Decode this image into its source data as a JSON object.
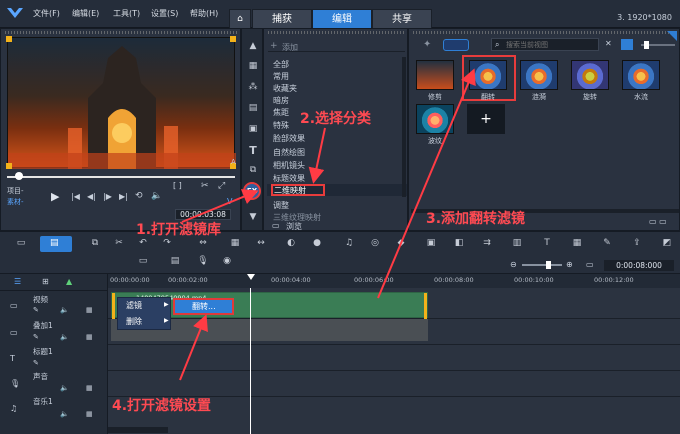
{
  "menu": {
    "file": "文件(F)",
    "edit": "编辑(E)",
    "tools": "工具(T)",
    "settings": "设置(S)",
    "help": "帮助(H)"
  },
  "tabs": {
    "capture": "捕获",
    "edit": "编辑",
    "share": "共享"
  },
  "resolution": "3. 1920*1080",
  "library": {
    "add": "添加",
    "search_placeholder": "搜索当前视图",
    "browse": "浏览"
  },
  "categories": [
    "全部",
    "常用",
    "收藏夹",
    "暗房",
    "焦距",
    "特殊",
    "脸部效果",
    "自然绘图",
    "相机镜头",
    "标题效果",
    "二维映射",
    "调整",
    "三维纹理映射"
  ],
  "selected_category": "二维映射",
  "thumbs": [
    {
      "label": "修剪"
    },
    {
      "label": "翻转"
    },
    {
      "label": "涟漪"
    },
    {
      "label": "旋转"
    },
    {
      "label": "水流"
    },
    {
      "label": "波纹"
    }
  ],
  "preview": {
    "project": "项目-",
    "clip": "素材-",
    "timecode": "00:00:03:08"
  },
  "timeline": {
    "ruler": [
      "00:00:00:00",
      "00:00:02:00",
      "00:00:04:00",
      "00:00:06:00",
      "00:00:08:00",
      "00:00:10:00",
      "00:00:12:00"
    ],
    "total": "0:00:08:000",
    "clip_name": "1489479540904.mp4"
  },
  "tracks": [
    "视频",
    "叠加1",
    "标题1",
    "声音",
    "音乐1"
  ],
  "context_menu": {
    "filter": "滤镜",
    "delete": "删除",
    "flip": "翻转..."
  },
  "annotations": {
    "a1": "1.打开滤镜库",
    "a2": "2.选择分类",
    "a3": "3.添加翻转滤镜",
    "a4": "4.打开滤镜设置"
  },
  "colors": {
    "accent": "#2f7fd6",
    "annotation": "#ff4a52",
    "clip": "#3a7d55"
  }
}
